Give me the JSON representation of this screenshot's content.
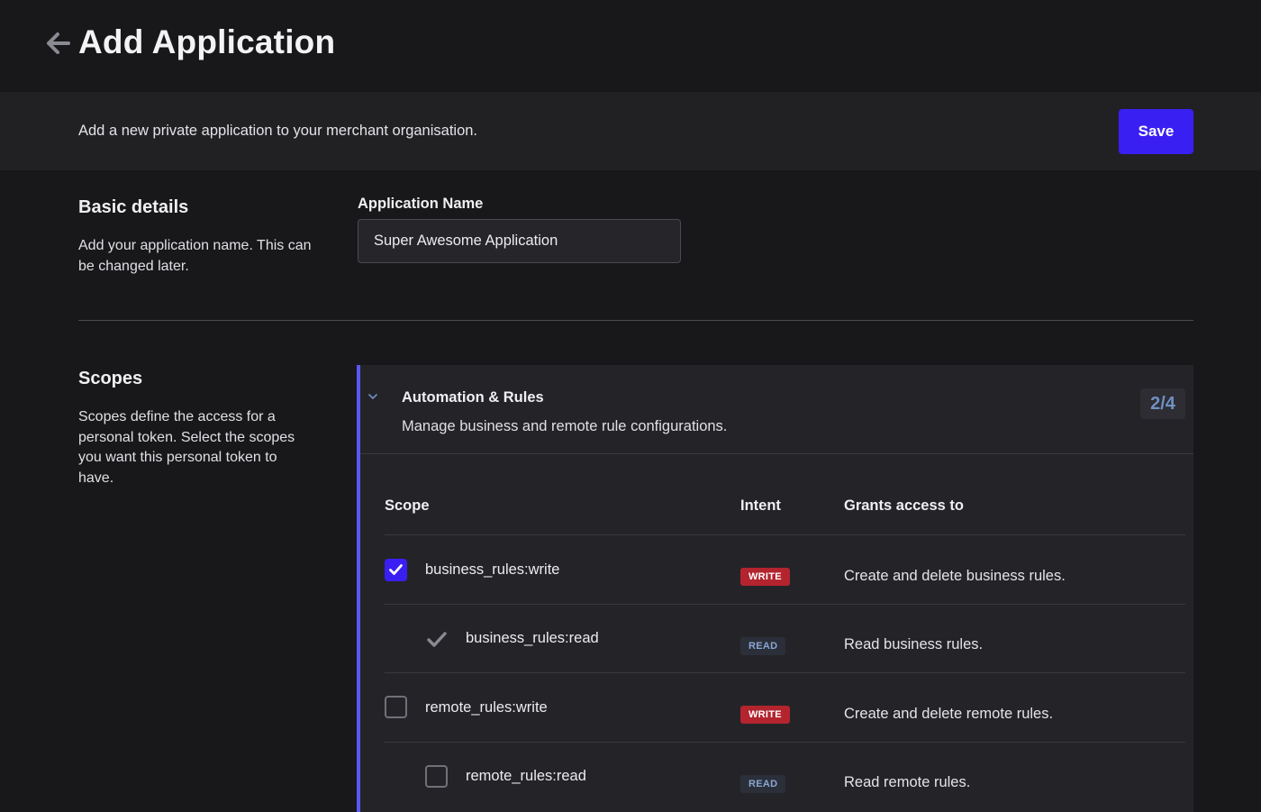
{
  "header": {
    "title": "Add Application",
    "back_icon": "arrow-left-icon"
  },
  "subheader": {
    "description": "Add a new private application to your merchant organisation.",
    "save_label": "Save",
    "accent_color": "#3a1ff2"
  },
  "basic_details": {
    "title": "Basic details",
    "description": "Add your application name. This can be changed later.",
    "field_label": "Application Name",
    "field_value": "Super Awesome Application"
  },
  "scopes": {
    "title": "Scopes",
    "description": "Scopes define the access for a personal token. Select the scopes you want this personal token to have.",
    "group": {
      "title": "Automation & Rules",
      "description": "Manage business and remote rule configurations.",
      "count": "2/4",
      "expanded": true
    },
    "columns": {
      "scope": "Scope",
      "intent": "Intent",
      "grants": "Grants access to"
    },
    "rows": [
      {
        "name": "business_rules:write",
        "intent": "WRITE",
        "grants": "Create and delete business rules.",
        "state": "checked"
      },
      {
        "name": "business_rules:read",
        "intent": "READ",
        "grants": "Read business rules.",
        "state": "implied"
      },
      {
        "name": "remote_rules:write",
        "intent": "WRITE",
        "grants": "Create and delete remote rules.",
        "state": "unchecked"
      },
      {
        "name": "remote_rules:read",
        "intent": "READ",
        "grants": "Read remote rules.",
        "state": "unchecked"
      }
    ]
  }
}
